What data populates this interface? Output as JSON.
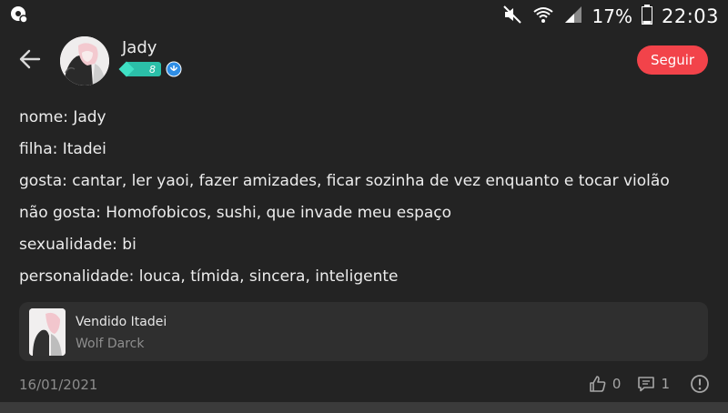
{
  "status_bar": {
    "battery_percent": "17%",
    "time": "22:03",
    "icons": [
      "notification-icon",
      "mute-icon",
      "wifi-icon",
      "signal-icon",
      "battery-icon"
    ],
    "battery_level": 0.17
  },
  "header": {
    "username": "Jady",
    "level": "8",
    "follow_label": "Seguir",
    "accent_color": "#f2434a",
    "level_color": "#2bbfa8"
  },
  "post": {
    "lines": [
      "nome: Jady",
      "filha: Itadei",
      "gosta: cantar, ler yaoi, fazer amizades, ficar sozinha de vez enquanto e tocar violão",
      "não gosta: Homofobicos, sushi, que invade meu espaço",
      "sexualidade: bi",
      "personalidade: louca, tímida, sincera, inteligente"
    ]
  },
  "linked_post": {
    "title": "Vendido Itadei",
    "author": "Wolf Darck"
  },
  "footer": {
    "date": "16/01/2021",
    "likes": "0",
    "comments": "1"
  }
}
